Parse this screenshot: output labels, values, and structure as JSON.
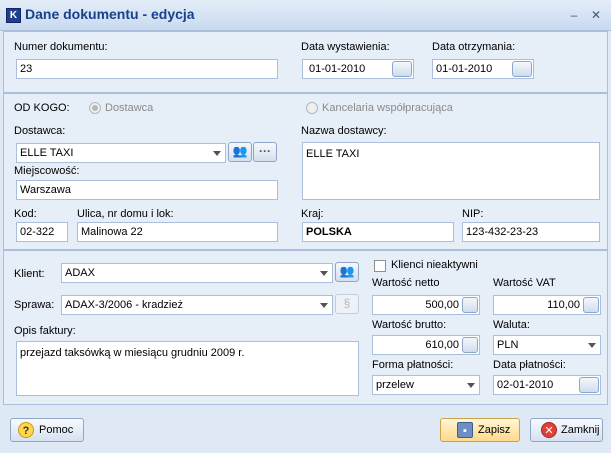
{
  "window": {
    "title": "Dane dokumentu - edycja",
    "app_icon": "K",
    "minimize": "–",
    "close": "✕"
  },
  "doc": {
    "number_label": "Numer dokumentu:",
    "number_value": "23",
    "issue_label": "Data wystawienia:",
    "issue_value": "01-01-2010",
    "received_label": "Data otrzymania:",
    "received_value": "01-01-2010"
  },
  "supplier": {
    "from_label": "OD KOGO:",
    "radio_supplier": "Dostawca",
    "radio_office": "Kancelaria współpracująca",
    "supplier_label": "Dostawca:",
    "supplier_value": "ELLE TAXI",
    "more_glyph": "···",
    "name_label": "Nazwa dostawcy:",
    "name_value": "ELLE TAXI",
    "city_label": "Miejscowość:",
    "city_value": "Warszawa",
    "zip_label": "Kod:",
    "zip_value": "02-322",
    "street_label": "Ulica, nr domu i lok:",
    "street_value": "Malinowa 22",
    "country_label": "Kraj:",
    "country_value": "POLSKA",
    "nip_label": "NIP:",
    "nip_value": "123-432-23-23"
  },
  "invoice": {
    "client_label": "Klient:",
    "client_value": "ADAX",
    "inactive_label": "Klienci nieaktywni",
    "case_label": "Sprawa:",
    "case_value": "ADAX-3/2006 - kradzież",
    "desc_label": "Opis faktury:",
    "desc_value": "przejazd taksówką w miesiącu grudniu 2009 r.",
    "net_label": "Wartość netto",
    "net_value": "500,00",
    "vat_label": "Wartość VAT",
    "vat_value": "110,00",
    "gross_label": "Wartość brutto:",
    "gross_value": "610,00",
    "currency_label": "Waluta:",
    "currency_value": "PLN",
    "payment_label": "Forma płatności:",
    "payment_value": "przelew",
    "paydate_label": "Data płatności:",
    "paydate_value": "02-01-2010"
  },
  "footer": {
    "help": "Pomoc",
    "save": "Zapisz",
    "close": "Zamknij"
  }
}
